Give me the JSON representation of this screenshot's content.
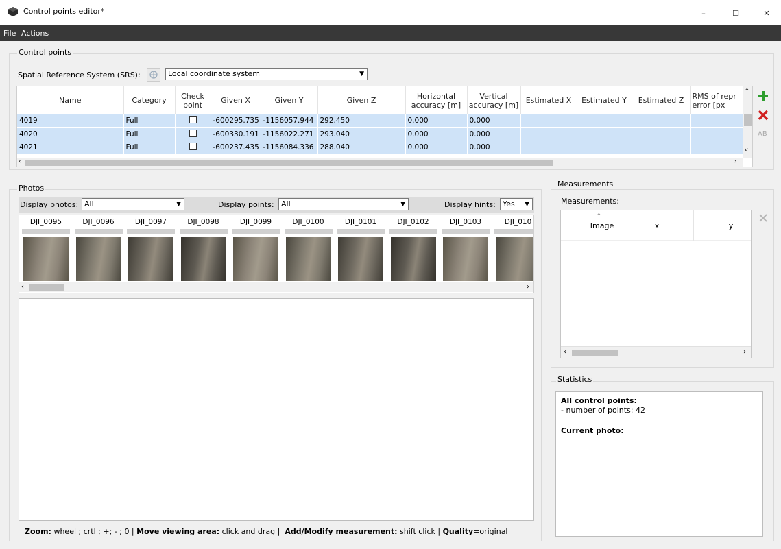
{
  "window": {
    "title": "Control points editor*",
    "minimize": "–",
    "maximize": "☐",
    "close": "✕"
  },
  "menu": [
    "File",
    "Actions"
  ],
  "control_points": {
    "group_title": "Control points",
    "srs_label": "Spatial Reference System (SRS):",
    "srs_value": "Local coordinate system",
    "columns": [
      "Name",
      "Category",
      "Check point",
      "Given X",
      "Given Y",
      "Given Z",
      "Horizontal accuracy [m]",
      "Vertical accuracy [m]",
      "Estimated X",
      "Estimated Y",
      "Estimated Z",
      "RMS of repr error [px"
    ],
    "rows": [
      {
        "name": "4019",
        "category": "Full",
        "x": "-600295.735",
        "y": "-1156057.944",
        "z": "292.450",
        "h_acc": "0.000",
        "v_acc": "0.000"
      },
      {
        "name": "4020",
        "category": "Full",
        "x": "-600330.191",
        "y": "-1156022.271",
        "z": "293.040",
        "h_acc": "0.000",
        "v_acc": "0.000"
      },
      {
        "name": "4021",
        "category": "Full",
        "x": "-600237.435",
        "y": "-1156084.336",
        "z": "288.040",
        "h_acc": "0.000",
        "v_acc": "0.000"
      }
    ]
  },
  "photos": {
    "group_title": "Photos",
    "display_photos_label": "Display photos:",
    "display_photos_value": "All",
    "display_points_label": "Display points:",
    "display_points_value": "All",
    "display_hints_label": "Display hints:",
    "display_hints_value": "Yes",
    "thumbnails": [
      "DJI_0095",
      "DJI_0096",
      "DJI_0097",
      "DJI_0098",
      "DJI_0099",
      "DJI_0100",
      "DJI_0101",
      "DJI_0102",
      "DJI_0103",
      "DJI_010"
    ]
  },
  "status_bar": {
    "zoom_label": "Zoom:",
    "zoom_text": "wheel ; crtl ; +; - ; 0 |",
    "move_label": "Move viewing area:",
    "move_text": "click and drag |",
    "add_label": "Add/Modify measurement:",
    "add_text": "shift click |",
    "quality_label": "Quality",
    "quality_text": "=original"
  },
  "measurements": {
    "group_title": "Measurements",
    "label": "Measurements:",
    "columns": [
      "Image",
      "x",
      "y"
    ]
  },
  "statistics": {
    "group_title": "Statistics",
    "all_points_heading": "All control points:",
    "num_points": "- number of points: 42",
    "current_photo_heading": "Current photo:"
  },
  "colors": {
    "selected_row": "#cfe3f8",
    "menubar": "#383838",
    "add_icon": "#2e9e2e",
    "delete_icon": "#d12020"
  }
}
